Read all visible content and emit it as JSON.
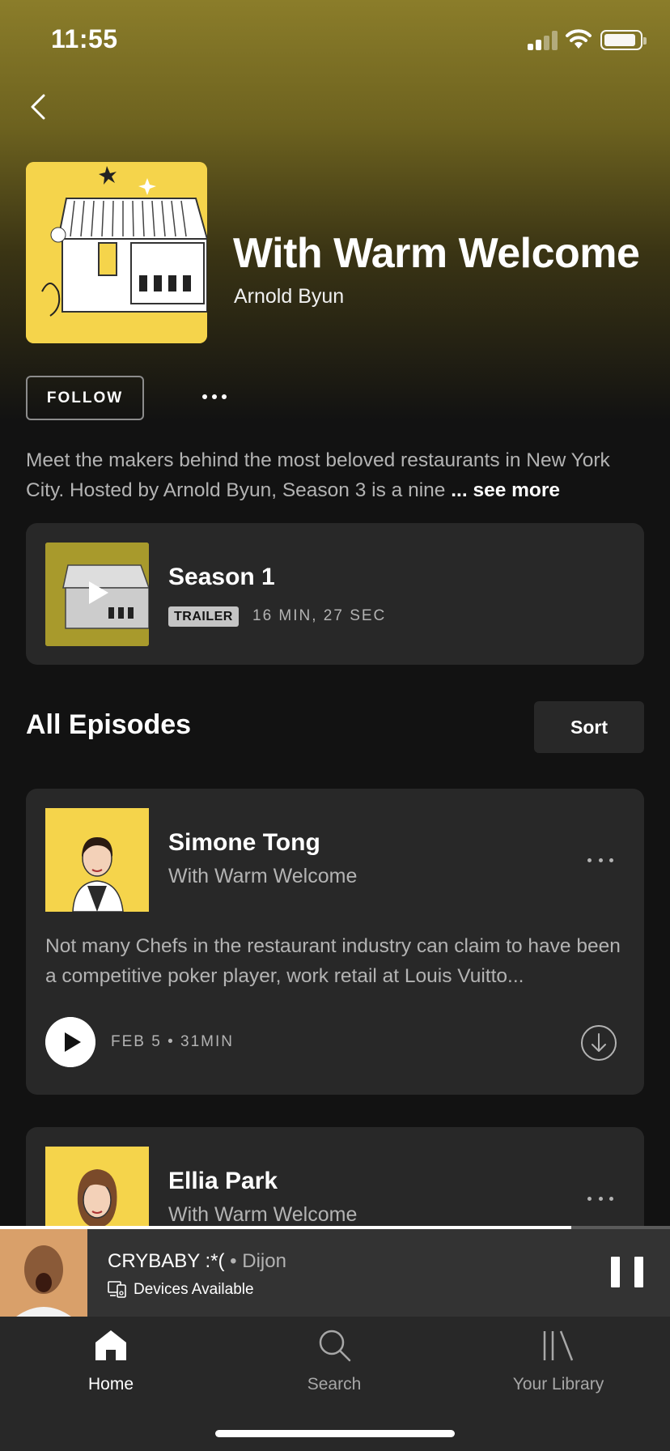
{
  "status_bar": {
    "time": "11:55"
  },
  "podcast": {
    "title": "With Warm Welcome",
    "author": "Arnold Byun",
    "follow_label": "FOLLOW",
    "description": "Meet the makers behind the most beloved restaurants in New York City. Hosted by Arnold Byun, Season 3 is a nine ",
    "see_more_label": "... see more"
  },
  "trailer": {
    "title": "Season 1",
    "badge": "TRAILER",
    "duration": "16 MIN, 27 SEC"
  },
  "episodes_section": {
    "title": "All Episodes",
    "sort_label": "Sort"
  },
  "episodes": [
    {
      "title": "Simone Tong",
      "show": "With Warm Welcome",
      "description": "Not many Chefs in the restaurant industry can claim to have been a competitive poker player, work retail at Louis Vuitto...",
      "meta": "FEB 5 • 31MIN"
    },
    {
      "title": "Ellia Park",
      "show": "With Warm Welcome"
    }
  ],
  "now_playing": {
    "title": "CRYBABY :*( ",
    "artist": "• Dijon",
    "devices": "Devices Available",
    "progress": 0.853
  },
  "tabs": [
    {
      "label": "Home",
      "icon": "home-icon",
      "active": true
    },
    {
      "label": "Search",
      "icon": "search-icon",
      "active": false
    },
    {
      "label": "Your Library",
      "icon": "library-icon",
      "active": false
    }
  ],
  "colors": {
    "hero": "#8b7d2a",
    "background": "#121212",
    "card": "#282828",
    "cover": "#f5d44b"
  }
}
